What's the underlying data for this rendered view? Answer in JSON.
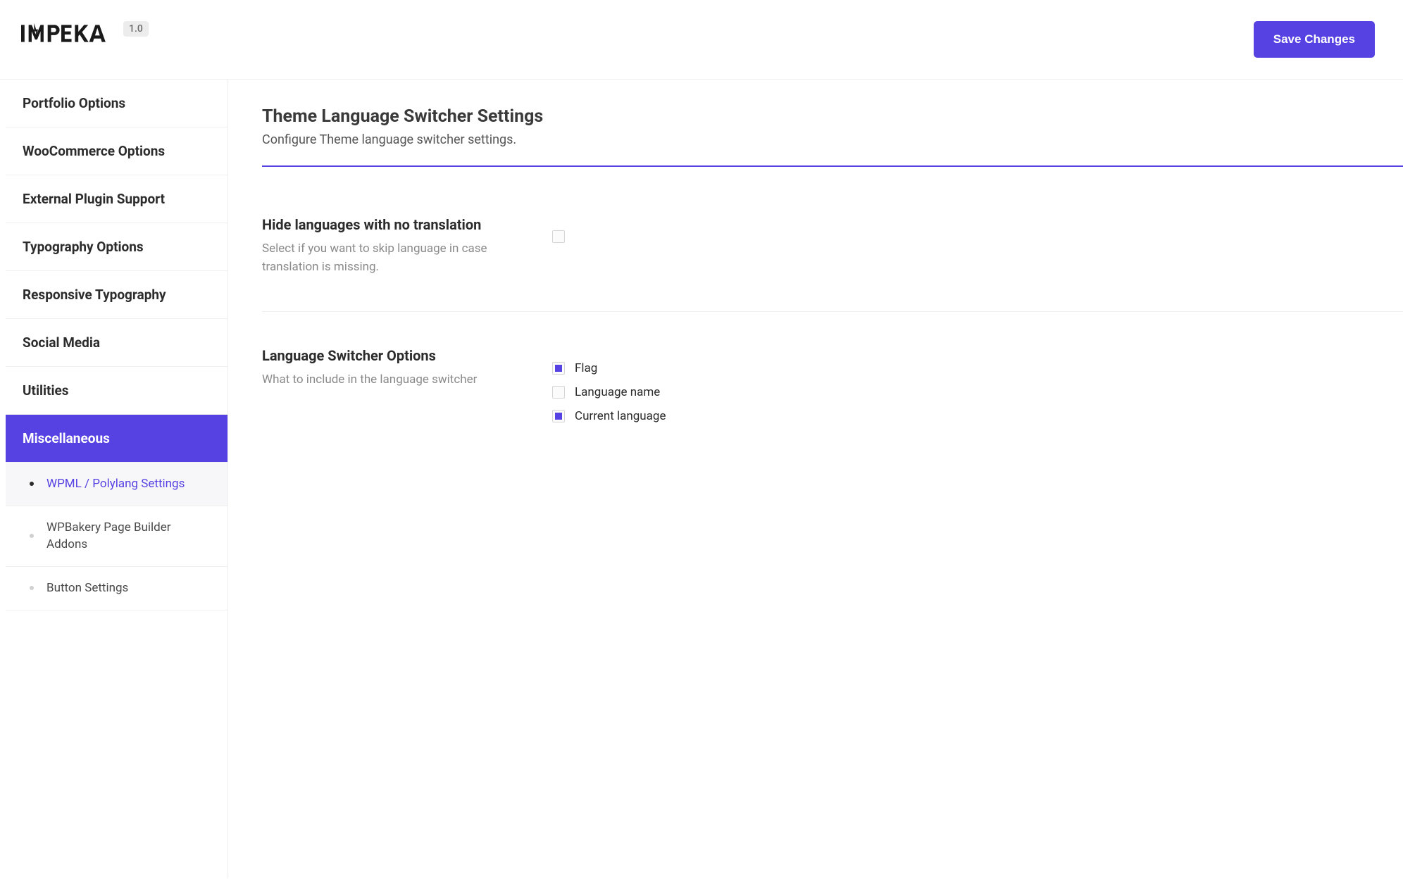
{
  "header": {
    "logo_text": "IMPEKA",
    "version": "1.0",
    "save_label": "Save Changes"
  },
  "sidebar": {
    "items": [
      {
        "label": "Portfolio Options",
        "active": false
      },
      {
        "label": "WooCommerce Options",
        "active": false
      },
      {
        "label": "External Plugin Support",
        "active": false
      },
      {
        "label": "Typography Options",
        "active": false
      },
      {
        "label": "Responsive Typography",
        "active": false
      },
      {
        "label": "Social Media",
        "active": false
      },
      {
        "label": "Utilities",
        "active": false
      },
      {
        "label": "Miscellaneous",
        "active": true
      }
    ],
    "sub_items": [
      {
        "label": "WPML / Polylang Settings",
        "active": true
      },
      {
        "label": "WPBakery Page Builder Addons",
        "active": false
      },
      {
        "label": "Button Settings",
        "active": false
      }
    ]
  },
  "content": {
    "title": "Theme Language Switcher Settings",
    "subtitle": "Configure Theme language switcher settings.",
    "settings": [
      {
        "label": "Hide languages with no translation",
        "desc": "Select if you want to skip language in case translation is missing.",
        "type": "checkbox",
        "checked": false
      },
      {
        "label": "Language Switcher Options",
        "desc": "What to include in the language switcher",
        "type": "checklist",
        "options": [
          {
            "label": "Flag",
            "checked": true
          },
          {
            "label": "Language name",
            "checked": false
          },
          {
            "label": "Current language",
            "checked": true
          }
        ]
      }
    ]
  }
}
